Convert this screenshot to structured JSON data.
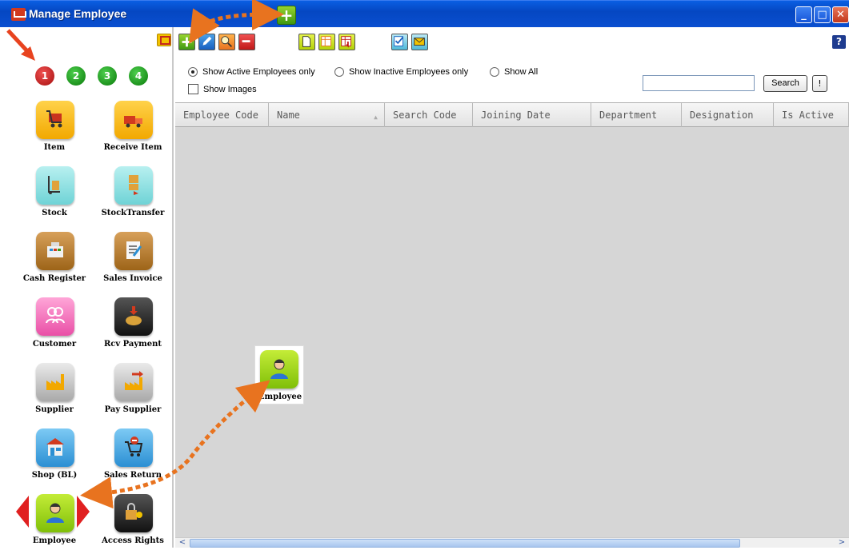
{
  "window": {
    "title": "Manage Employee",
    "controls": [
      "_",
      "□",
      "✕"
    ]
  },
  "sidebar": {
    "pages": [
      "1",
      "2",
      "3",
      "4"
    ],
    "active_page": "1",
    "modules": [
      {
        "label": "Item",
        "icon": "shopping-cart-icon"
      },
      {
        "label": "Receive Item",
        "icon": "truck-icon"
      },
      {
        "label": "Stock",
        "icon": "hand-truck-icon"
      },
      {
        "label": "StockTransfer",
        "icon": "box-transfer-icon"
      },
      {
        "label": "Cash Register",
        "icon": "cash-register-icon"
      },
      {
        "label": "Sales Invoice",
        "icon": "invoice-icon"
      },
      {
        "label": "Customer",
        "icon": "customers-icon"
      },
      {
        "label": "Rcv Payment",
        "icon": "money-bag-icon"
      },
      {
        "label": "Supplier",
        "icon": "factory-icon"
      },
      {
        "label": "Pay Supplier",
        "icon": "factory-payment-icon"
      },
      {
        "label": "Shop (BL)",
        "icon": "shop-icon"
      },
      {
        "label": "Sales Return",
        "icon": "cart-return-icon"
      },
      {
        "label": "Employee",
        "icon": "employee-icon"
      },
      {
        "label": "Access Rights",
        "icon": "key-lock-icon"
      }
    ]
  },
  "toolbar": {
    "add": "+",
    "help": "?"
  },
  "filters": {
    "active_only": "Show Active Employees only",
    "inactive_only": "Show Inactive Employees only",
    "show_all": "Show All",
    "selected": "active_only",
    "show_images": "Show Images",
    "search_value": "",
    "search_button": "Search",
    "bang_button": "!"
  },
  "grid": {
    "columns": [
      "Employee Code",
      "Name",
      "Search Code",
      "Joining Date",
      "Department",
      "Designation",
      "Is Active"
    ],
    "sorted_column": "Name",
    "rows": []
  },
  "floating_tile": {
    "label": "Employee"
  },
  "colors": {
    "titlebar": "#0547c2",
    "accent_orange": "#e8731f",
    "arrow_red": "#e8431f",
    "grid_background": "#d6d6d6"
  }
}
